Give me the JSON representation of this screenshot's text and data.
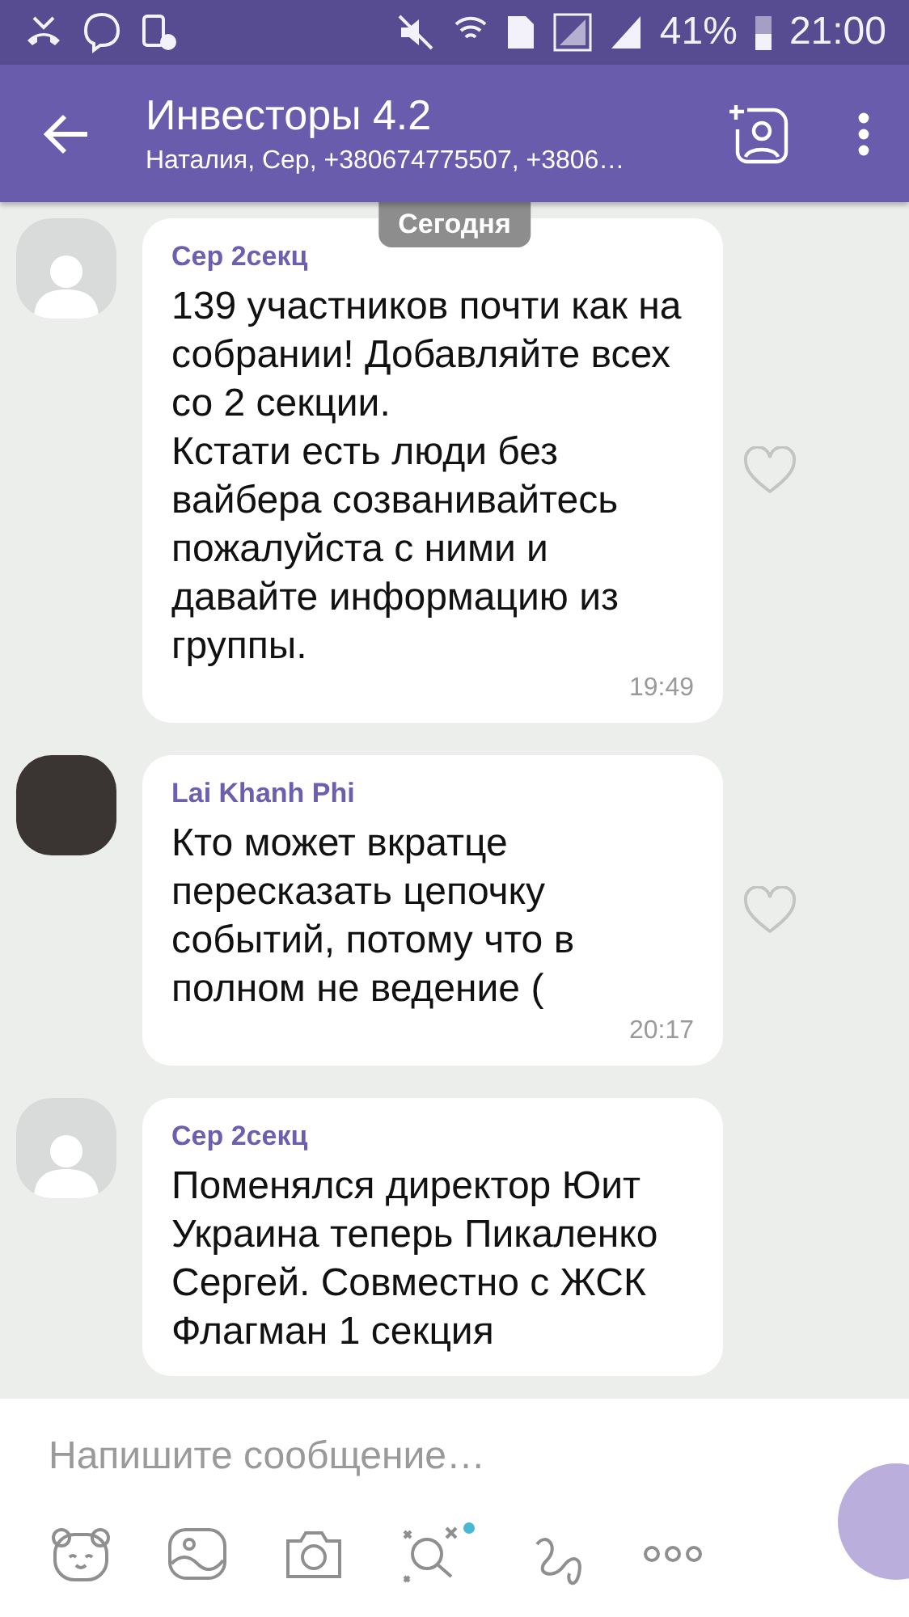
{
  "status_bar": {
    "battery": "41%",
    "time": "21:00"
  },
  "header": {
    "title": "Инвесторы 4.2",
    "subtitle": "Наталия, Сер, +380674775507, +3806…"
  },
  "date_badge": "Сегодня",
  "messages": [
    {
      "avatar": {
        "kind": "placeholder"
      },
      "sender": "Сер 2секц",
      "text": "139 участников почти как на собрании! Добавляйте всех со 2 секции.\nКстати есть люди без вайбера созванивайтесь пожалуйста с ними и давайте информацию из группы.",
      "time": "19:49"
    },
    {
      "avatar": {
        "kind": "photo"
      },
      "sender": "Lai Khanh Phi",
      "text": "Кто может вкратце пересказать цепочку событий, потому что в полном не ведение (",
      "time": "20:17"
    },
    {
      "avatar": {
        "kind": "placeholder"
      },
      "sender": "Сер 2секц",
      "text": "Поменялся директор Юит Украина теперь Пикаленко Сергей. Совместно с ЖСК Флагман 1 секция"
    }
  ],
  "composer": {
    "placeholder": "Напишите сообщение…"
  }
}
